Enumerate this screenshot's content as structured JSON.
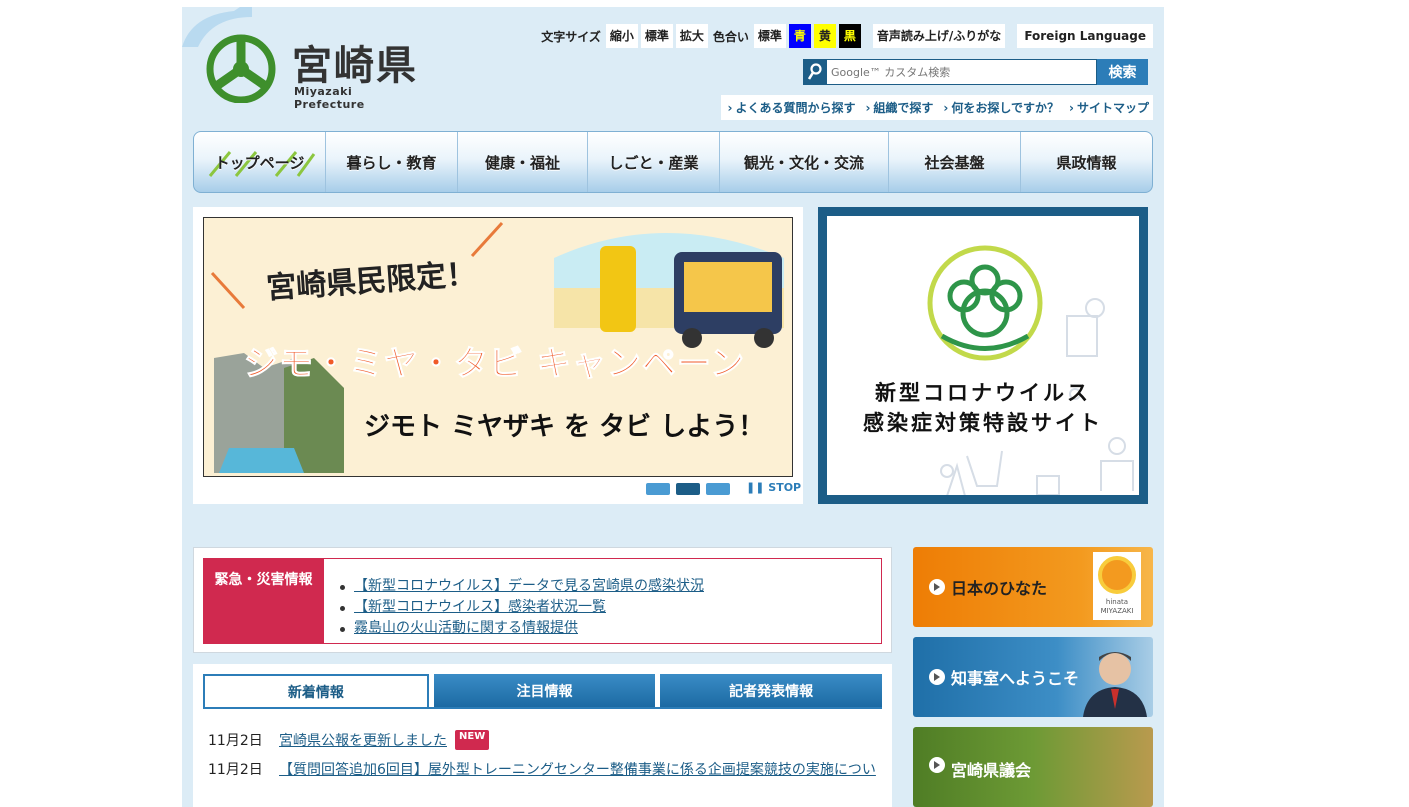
{
  "header": {
    "logo_text": "宮崎県",
    "logo_sub": "Miyazaki Prefecture",
    "font_size_label": "文字サイズ",
    "font_small": "縮小",
    "font_standard": "標準",
    "font_large": "拡大",
    "color_label": "色合い",
    "color_standard": "標準",
    "color_blue": "青",
    "color_yellow": "黄",
    "color_black": "黒",
    "voice": "音声読み上げ/ふりがな",
    "foreign": "Foreign Language"
  },
  "search": {
    "placeholder": "Google™ カスタム検索",
    "button": "検索"
  },
  "links": [
    "よくある質問から探す",
    "組織で探す",
    "何をお探しですか？",
    "サイトマップ"
  ],
  "gnav": [
    "トップページ",
    "暮らし・教育",
    "健康・福祉",
    "しごと・産業",
    "観光・文化・交流",
    "社会基盤",
    "県政情報"
  ],
  "slider": {
    "banner_line1": "宮崎県民限定！",
    "banner_line2": "ジモ・ミヤ・タビ キャンペーン",
    "banner_line3": "ジモト ミヤザキ を タビ しよう！",
    "stop": "STOP",
    "slides": 3,
    "active_slide": 2
  },
  "corona": {
    "line1": "新型コロナウイルス",
    "line2": "感染症対策特設サイト"
  },
  "emergency": {
    "label": "緊急・災害情報",
    "items": [
      "【新型コロナウイルス】データで見る宮崎県の感染状況",
      "【新型コロナウイルス】感染者状況一覧",
      "霧島山の火山活動に関する情報提供"
    ]
  },
  "news": {
    "tabs": [
      "新着情報",
      "注目情報",
      "記者発表情報"
    ],
    "items": [
      {
        "date": "11月2日",
        "title": "宮崎県公報を更新しました",
        "badge": "NEW"
      },
      {
        "date": "11月2日",
        "title": "【質問回答追加6回目】屋外型トレーニングセンター整備事業に係る企画提案競技の実施につい"
      }
    ]
  },
  "side": {
    "hinata": "日本のひなた",
    "hinata_logo": "hinata MIYAZAKI",
    "governor": "知事室へようこそ",
    "assembly": "宮崎県議会"
  },
  "colors": {
    "primary": "#1c5d87",
    "accent": "#2c7db8",
    "emergency": "#d0294f",
    "page_bg": "#dcecf6"
  }
}
